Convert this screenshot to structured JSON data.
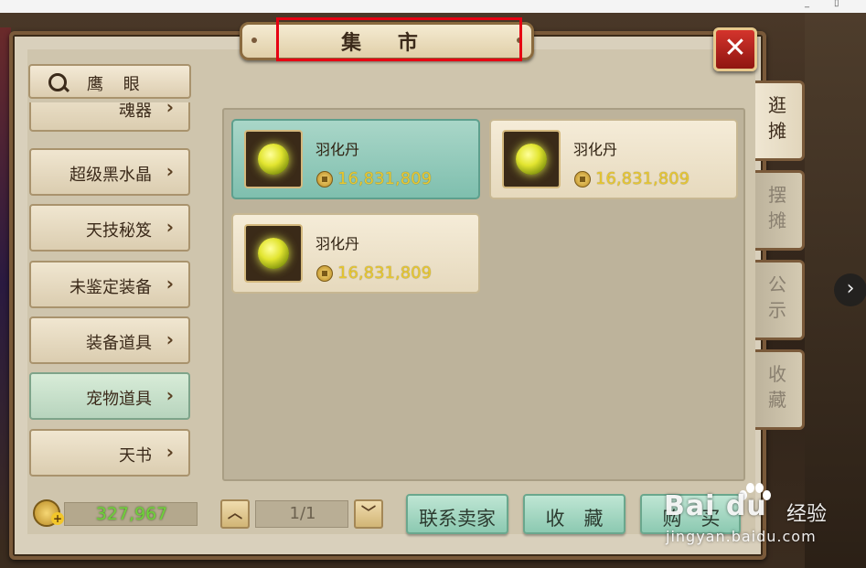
{
  "window": {
    "title": "集 市",
    "close_symbol": "✕"
  },
  "search": {
    "label": "鹰 眼"
  },
  "categories": [
    {
      "label": "魂器"
    },
    {
      "label": "超级黑水晶"
    },
    {
      "label": "天技秘笈"
    },
    {
      "label": "未鉴定装备"
    },
    {
      "label": "装备道具"
    },
    {
      "label": "宠物道具",
      "active": true
    },
    {
      "label": "天书"
    }
  ],
  "chevron": "›",
  "items": [
    {
      "name": "羽化丹",
      "price": "16,831,809",
      "selected": true
    },
    {
      "name": "羽化丹",
      "price": "16,831,809",
      "selected": false
    },
    {
      "name": "羽化丹",
      "price": "16,831,809",
      "selected": false
    }
  ],
  "wallet": {
    "amount": "327,967",
    "add_symbol": "+"
  },
  "pagination": {
    "text": "1/1",
    "up_symbol": "︿",
    "down_symbol": "﹀"
  },
  "actions": {
    "contact_seller": "联系卖家",
    "favorite": "收　藏",
    "buy": "购　买"
  },
  "side_tabs": [
    {
      "label": "逛摊",
      "active": true
    },
    {
      "label": "摆摊",
      "active": false
    },
    {
      "label": "公示",
      "active": false
    },
    {
      "label": "收藏",
      "active": false
    }
  ],
  "nav": {
    "next_symbol": "›"
  },
  "watermark": {
    "brand": "Bai  du",
    "product": "经验",
    "url": "jingyan.baidu.com"
  },
  "colors": {
    "selected_card": "#8cc9b1",
    "price": "#e8c830",
    "wallet_amount": "#6fd23a",
    "highlight_box": "#e60012"
  }
}
